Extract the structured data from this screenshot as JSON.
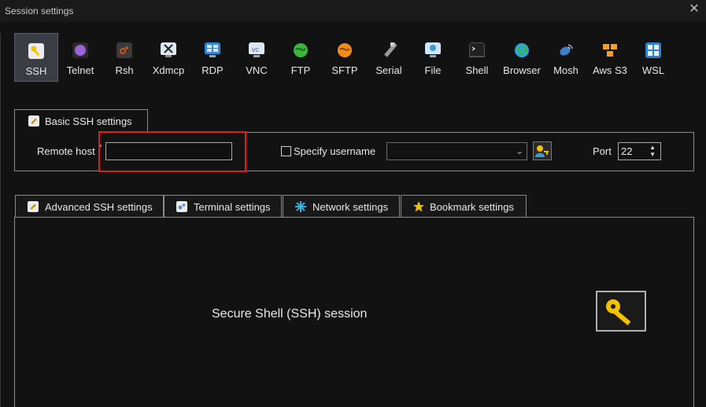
{
  "window": {
    "title": "Session settings",
    "close_glyph": "✕"
  },
  "toolbar": {
    "items": [
      {
        "label": "SSH",
        "icon": "key-icon",
        "color": "#f2c200",
        "active": true
      },
      {
        "label": "Telnet",
        "icon": "telnet-icon",
        "color": "#9a63d6"
      },
      {
        "label": "Rsh",
        "icon": "rsh-icon",
        "color": "#c8501e"
      },
      {
        "label": "Xdmcp",
        "icon": "xdmcp-icon",
        "color": "#5a7bb5"
      },
      {
        "label": "RDP",
        "icon": "rdp-icon",
        "color": "#2f8ad8"
      },
      {
        "label": "VNC",
        "icon": "vnc-icon",
        "color": "#3a6fb8"
      },
      {
        "label": "FTP",
        "icon": "ftp-icon",
        "color": "#3bb53b"
      },
      {
        "label": "SFTP",
        "icon": "sftp-icon",
        "color": "#f08c1c"
      },
      {
        "label": "Serial",
        "icon": "serial-icon",
        "color": "#9a9a9a"
      },
      {
        "label": "File",
        "icon": "file-icon",
        "color": "#3a9bd8"
      },
      {
        "label": "Shell",
        "icon": "shell-icon",
        "color": "#444444"
      },
      {
        "label": "Browser",
        "icon": "browser-icon",
        "color": "#2aa6d8"
      },
      {
        "label": "Mosh",
        "icon": "mosh-icon",
        "color": "#3d7fc8"
      },
      {
        "label": "Aws S3",
        "icon": "aws-s3-icon",
        "color": "#f0a030"
      },
      {
        "label": "WSL",
        "icon": "wsl-icon",
        "color": "#2d7fd0"
      }
    ]
  },
  "basic": {
    "tab_label": "Basic SSH settings",
    "remote_host_label": "Remote host",
    "required_mark": "*",
    "remote_host_value": "",
    "specify_username_label": "Specify username",
    "username_value": "",
    "port_label": "Port",
    "port_value": "22"
  },
  "lower_tabs": [
    {
      "label": "Advanced SSH settings",
      "icon": "wrench-icon",
      "color": "#f2c200"
    },
    {
      "label": "Terminal settings",
      "icon": "terminal-icon",
      "color": "#5a8ad0"
    },
    {
      "label": "Network settings",
      "icon": "network-icon",
      "color": "#3ab0e0"
    },
    {
      "label": "Bookmark settings",
      "icon": "star-icon",
      "color": "#f2c200"
    }
  ],
  "session": {
    "description": "Secure Shell (SSH) session"
  },
  "colors": {
    "highlight": "#e01b1b",
    "background": "#121212"
  }
}
